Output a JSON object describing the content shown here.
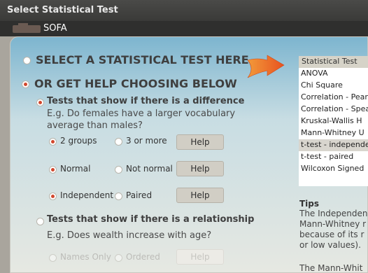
{
  "window": {
    "title": "Select Statistical Test"
  },
  "app": {
    "name": "SOFA"
  },
  "main": {
    "option_select_test": "SELECT A STATISTICAL TEST HERE",
    "option_get_help": "OR GET HELP CHOOSING BELOW",
    "difference": {
      "title": "Tests that show if there is a difference",
      "desc_line1": "E.g. Do females have a larger vocabulary",
      "desc_line2": "average than males?",
      "groups": {
        "opt1": "2 groups",
        "opt2": "3 or more",
        "help": "Help"
      },
      "normality": {
        "opt1": "Normal",
        "opt2": "Not normal",
        "help": "Help"
      },
      "independence": {
        "opt1": "Independent",
        "opt2": "Paired",
        "help": "Help"
      }
    },
    "relationship": {
      "title": "Tests that show if there is a relationship",
      "desc": "E.g. Does wealth increase with age?",
      "data_type": {
        "opt1": "Names Only",
        "opt2": "Ordered",
        "help": "Help"
      }
    }
  },
  "tests_list": {
    "header": "Statistical Test",
    "items": [
      "ANOVA",
      "Chi Square",
      "Correlation - Pear",
      "Correlation - Spea",
      "Kruskal-Wallis H",
      "Mann-Whitney U",
      "t-test - independe",
      "t-test - paired",
      "Wilcoxon Signed"
    ],
    "selected_index": 6
  },
  "tips": {
    "title": "Tips",
    "text": "The Independen\nMann-Whitney r\nbecause of its r\nor low values).",
    "more": "The Mann-Whit"
  },
  "colors": {
    "radio_selected": "#d1472d",
    "arrow": "#e8521f",
    "gradient_top": "#7db5cf"
  }
}
